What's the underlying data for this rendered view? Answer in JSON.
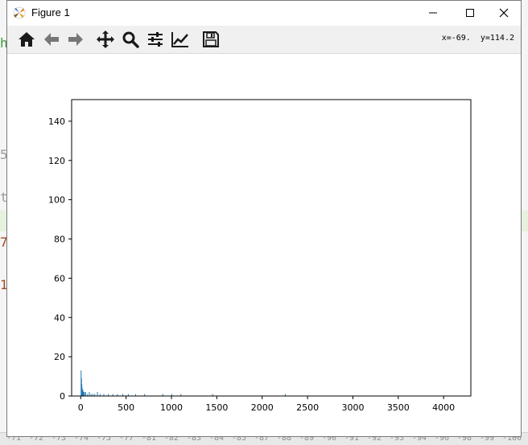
{
  "window": {
    "title": "Figure 1"
  },
  "toolbar": {
    "tools": [
      "home-icon",
      "back-arrow-icon",
      "forward-arrow-icon",
      "pan-move-icon",
      "zoom-magnifier-icon",
      "subplots-sliders-icon",
      "edit-axis-line-icon",
      "save-floppy-icon"
    ],
    "coords": "x=-69.  y=114.2"
  },
  "background": {
    "fragments": [
      "h",
      "5",
      "t",
      "7",
      "1"
    ],
    "ruler": [
      "-71",
      "-72",
      "-73",
      "-74",
      "-75",
      "-77",
      "-81",
      "-82",
      "-83",
      "-84",
      "-85",
      "-87",
      "-88",
      "-89",
      "-90",
      "-91",
      "-92",
      "-93",
      "-94",
      "-96",
      "-98",
      "-99",
      "-100"
    ]
  },
  "chart_data": {
    "type": "bar",
    "xlim": [
      -100,
      4300
    ],
    "ylim": [
      0,
      151
    ],
    "xticks": [
      0,
      500,
      1000,
      1500,
      2000,
      2500,
      3000,
      3500,
      4000
    ],
    "yticks": [
      0,
      20,
      40,
      60,
      80,
      100,
      120,
      140
    ],
    "color": "#1f77b4",
    "x": [
      0,
      4,
      8,
      12,
      16,
      20,
      28,
      36,
      50,
      70,
      90,
      110,
      130,
      150,
      180,
      210,
      250,
      300,
      350,
      400,
      460,
      520,
      600,
      700,
      900,
      1000,
      1100,
      1450,
      2250
    ],
    "values": [
      13,
      9,
      6,
      4,
      3,
      3,
      2,
      2,
      2,
      1,
      2,
      1,
      1,
      1,
      2,
      1,
      1,
      1,
      1,
      1,
      1,
      1,
      1,
      1,
      1,
      1,
      1,
      1,
      1
    ],
    "title": "",
    "xlabel": "",
    "ylabel": ""
  }
}
